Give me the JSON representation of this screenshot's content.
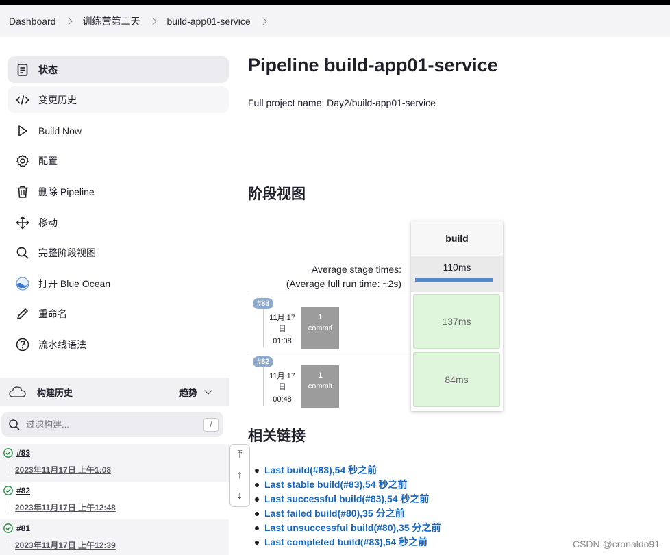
{
  "breadcrumb": [
    "Dashboard",
    "训练营第二天",
    "build-app01-service"
  ],
  "sidebar": {
    "tasks": [
      {
        "label": "状态",
        "icon": "status-doc-icon"
      },
      {
        "label": "变更历史",
        "icon": "code-icon"
      },
      {
        "label": "Build Now",
        "icon": "play-icon"
      },
      {
        "label": "配置",
        "icon": "gear-icon"
      },
      {
        "label": "删除 Pipeline",
        "icon": "trash-icon"
      },
      {
        "label": "移动",
        "icon": "move-icon"
      },
      {
        "label": "完整阶段视图",
        "icon": "search-icon"
      },
      {
        "label": "打开 Blue Ocean",
        "icon": "blue-ocean-icon"
      },
      {
        "label": "重命名",
        "icon": "pencil-icon"
      },
      {
        "label": "流水线语法",
        "icon": "help-icon"
      }
    ]
  },
  "build_history": {
    "title": "构建历史",
    "trend": "趋势",
    "filter_placeholder": "过滤构建...",
    "filter_key": "/",
    "builds": [
      {
        "number": "#83",
        "date": "2023年11月17日 上午1:08"
      },
      {
        "number": "#82",
        "date": "2023年11月17日 上午12:48"
      },
      {
        "number": "#81",
        "date": "2023年11月17日 上午12:39"
      }
    ]
  },
  "main": {
    "title": "Pipeline build-app01-service",
    "full_name": "Full project name: Day2/build-app01-service",
    "stage_view_title": "阶段视图",
    "related_title": "相关链接"
  },
  "stage_view": {
    "avg_label": "Average stage times:",
    "avg_full_prefix": "(Average ",
    "avg_full_link": "full",
    "avg_full_suffix": " run time: ~2s)",
    "stage_name": "build",
    "stage_avg": "110ms",
    "stage_avg_fraction": 1.0,
    "runs": [
      {
        "badge": "#83",
        "date_line1": "11月 17",
        "date_line2": "日",
        "time": "01:08",
        "commit_count": "1",
        "commit_label": "commit",
        "duration": "137ms"
      },
      {
        "badge": "#82",
        "date_line1": "11月 17",
        "date_line2": "日",
        "time": "00:48",
        "commit_count": "1",
        "commit_label": "commit",
        "duration": "84ms"
      }
    ]
  },
  "related_links": [
    "Last build(#83),54 秒之前",
    "Last stable build(#83),54 秒之前",
    "Last successful build(#83),54 秒之前",
    "Last failed build(#80),35 分之前",
    "Last unsuccessful build(#80),35 分之前",
    "Last completed build(#83),54 秒之前"
  ],
  "watermark": "CSDN @cronaldo91",
  "colors": {
    "link": "#1567c3",
    "success_cell": "#dff6dc",
    "progress": "#5688c7",
    "badge": "#8ca8cc"
  }
}
